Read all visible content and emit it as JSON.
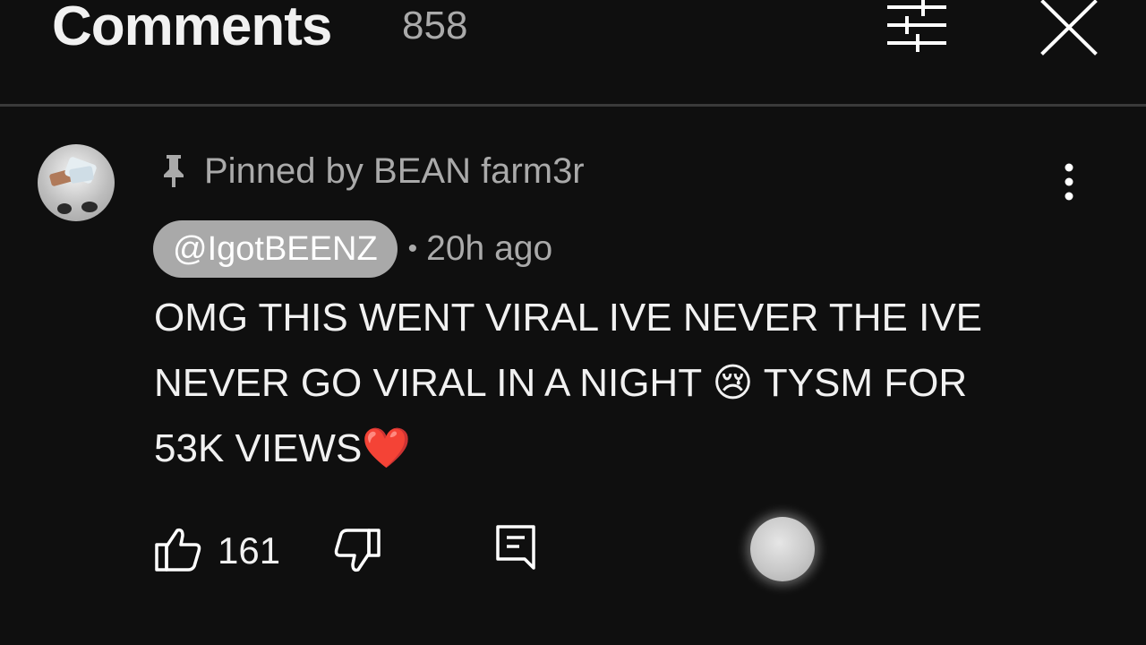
{
  "header": {
    "title": "Comments",
    "count": "858",
    "filter_icon": "filter-sliders-icon",
    "close_icon": "close-icon"
  },
  "comment": {
    "pinned_label": "Pinned by BEAN farm3r",
    "author": "@IgotBEENZ",
    "separator": "•",
    "time": "20h ago",
    "text": "OMG THIS WENT VIRAL IVE NEVER THE IVE\nNEVER GO VIRAL IN A NIGHT 😢 TYSM FOR\n53K VIEWS❤️",
    "likes": "161",
    "icons": {
      "pin": "pin-icon",
      "more": "more-vertical-icon",
      "like": "thumbs-up-icon",
      "dislike": "thumbs-down-icon",
      "reply": "reply-comment-icon"
    }
  },
  "colors": {
    "background": "#0f0f0f",
    "text_primary": "#f1f1f1",
    "text_secondary": "#aaaaaa",
    "author_chip": "#a9a9a9"
  }
}
